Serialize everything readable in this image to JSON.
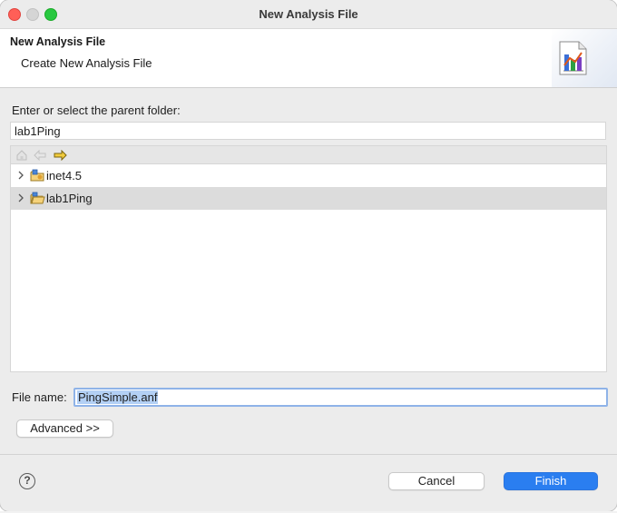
{
  "window": {
    "title": "New Analysis File"
  },
  "banner": {
    "title": "New Analysis File",
    "subtitle": "Create New Analysis File",
    "icon": "analysis-chart-icon"
  },
  "parent_folder": {
    "label": "Enter or select the parent folder:",
    "value": "lab1Ping"
  },
  "tree_toolbar": {
    "buttons": [
      {
        "name": "home-icon",
        "enabled": false
      },
      {
        "name": "back-arrow-icon",
        "enabled": false
      },
      {
        "name": "forward-arrow-icon",
        "enabled": true
      }
    ]
  },
  "tree": {
    "items": [
      {
        "label": "inet4.5",
        "selected": false,
        "icon": "project-folder-icon",
        "expanded": false
      },
      {
        "label": "lab1Ping",
        "selected": true,
        "icon": "open-project-folder-icon",
        "expanded": false
      }
    ]
  },
  "file_name": {
    "label": "File name:",
    "value": "PingSimple.anf"
  },
  "buttons": {
    "advanced": "Advanced >>",
    "cancel": "Cancel",
    "finish": "Finish",
    "help": "?"
  },
  "colors": {
    "accent": "#2a7ef0",
    "selection": "#dcdcdc",
    "focus_ring": "#8fb3e8",
    "text_selection": "#b3d0f5"
  }
}
